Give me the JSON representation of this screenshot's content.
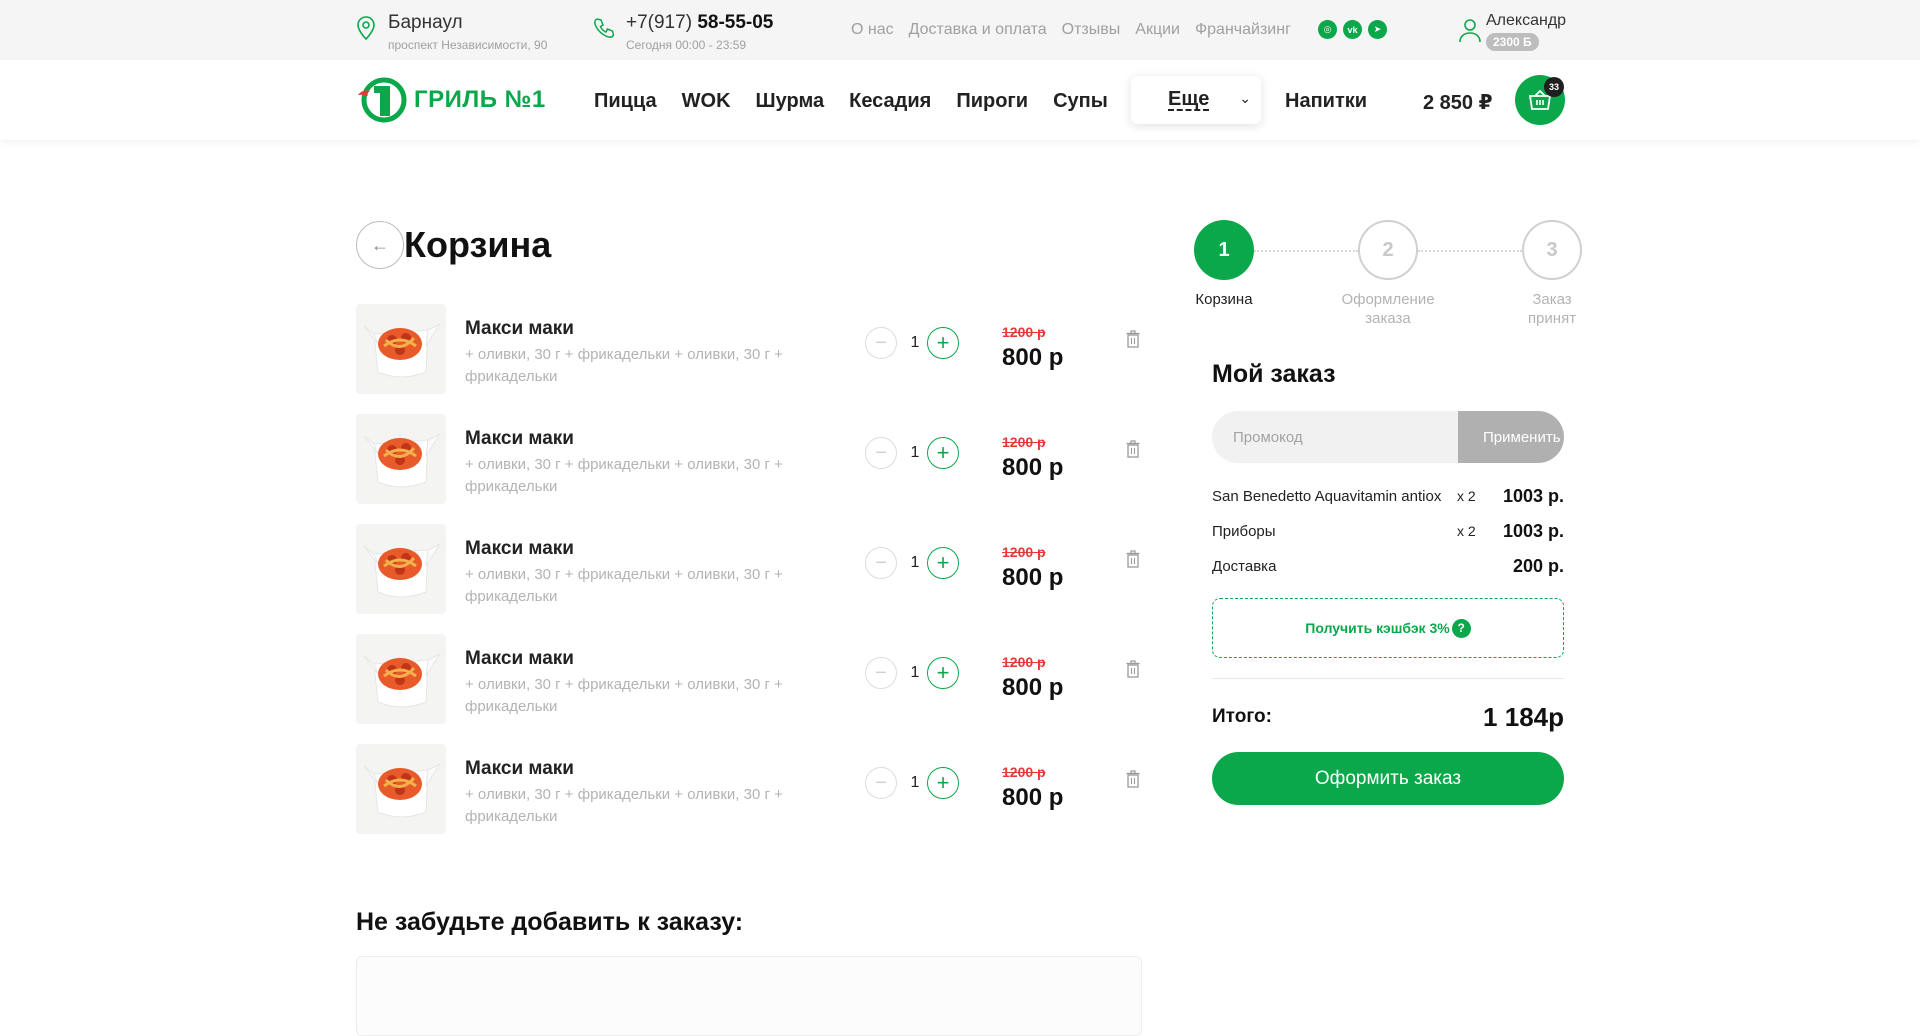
{
  "topbar": {
    "city": "Барнаул",
    "address": "проспект Независимости, 90",
    "phone_prefix": "+7(917)",
    "phone_main": "58-55-05",
    "hours": "Сегодня 00:00 - 23:59",
    "links": [
      "О нас",
      "Доставка и оплата",
      "Отзывы",
      "Акции",
      "Франчайзинг"
    ],
    "socials": [
      "instagram-icon",
      "vk-icon",
      "telegram-icon"
    ],
    "user_name": "Александр",
    "bonus": "2300 Б"
  },
  "header": {
    "logo_text": "ГРИЛЬ №1",
    "nav": [
      "Пицца",
      "WOK",
      "Шурма",
      "Кесадия",
      "Пироги",
      "Супы"
    ],
    "more_label": "Еще",
    "drinks_label": "Напитки",
    "cart_total": "2 850 ₽",
    "cart_count": "33"
  },
  "cart": {
    "title": "Корзина",
    "items": [
      {
        "name": "Макси маки",
        "desc": "+ оливки, 30 г + фрикадельки + оливки, 30 г + фрикадельки",
        "qty": "1",
        "old_price": "1200 р",
        "price": "800 р"
      },
      {
        "name": "Макси маки",
        "desc": "+ оливки, 30 г + фрикадельки + оливки, 30 г + фрикадельки",
        "qty": "1",
        "old_price": "1200 р",
        "price": "800 р"
      },
      {
        "name": "Макси маки",
        "desc": "+ оливки, 30 г + фрикадельки + оливки, 30 г + фрикадельки",
        "qty": "1",
        "old_price": "1200 р",
        "price": "800 р"
      },
      {
        "name": "Макси маки",
        "desc": "+ оливки, 30 г + фрикадельки + оливки, 30 г + фрикадельки",
        "qty": "1",
        "old_price": "1200 р",
        "price": "800 р"
      },
      {
        "name": "Макси маки",
        "desc": "+ оливки, 30 г + фрикадельки + оливки, 30 г + фрикадельки",
        "qty": "1",
        "old_price": "1200 р",
        "price": "800 р"
      }
    ],
    "recommend_title": "Не забудьте добавить к заказу:"
  },
  "steps": [
    {
      "num": "1",
      "label": "Корзина",
      "active": true
    },
    {
      "num": "2",
      "label": "Оформление заказа",
      "active": false
    },
    {
      "num": "3",
      "label": "Заказ принят",
      "active": false
    }
  ],
  "order": {
    "title": "Мой заказ",
    "promo_placeholder": "Промокод",
    "apply_label": "Применить",
    "rows": [
      {
        "name": "San Benedetto Aquavitamin antiox",
        "qty": "x 2",
        "price": "1003 р."
      },
      {
        "name": "Приборы",
        "qty": "x 2",
        "price": "1003 р."
      },
      {
        "name": "Доставка",
        "qty": "",
        "price": "200 р."
      }
    ],
    "cashback_label": "Получить кэшбэк 3%",
    "total_label": "Итого:",
    "total_value": "1 184р",
    "checkout_label": "Оформить заказ"
  },
  "colors": {
    "accent": "#0aa84a",
    "old_price": "#e53935",
    "muted": "#b3b3b3"
  }
}
